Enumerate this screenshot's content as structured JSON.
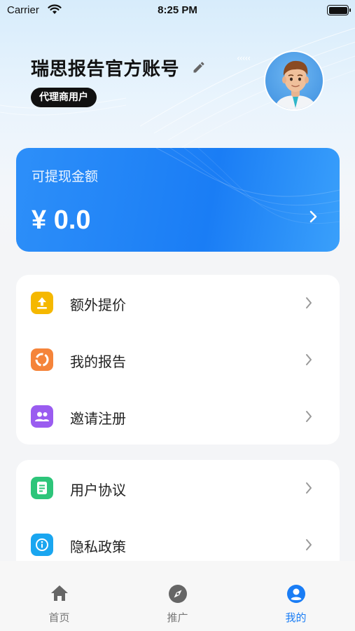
{
  "status": {
    "carrier": "Carrier",
    "time": "8:25 PM"
  },
  "profile": {
    "name": "瑞思报告官方账号",
    "role": "代理商用户"
  },
  "balance": {
    "label": "可提现金额",
    "amount": "¥ 0.0"
  },
  "menu_group_1": [
    {
      "label": "额外提价",
      "icon": "upload-icon",
      "color": "#F5B800"
    },
    {
      "label": "我的报告",
      "icon": "report-cycle-icon",
      "color": "#F5843A"
    },
    {
      "label": "邀请注册",
      "icon": "people-icon",
      "color": "#9A5CF0"
    }
  ],
  "menu_group_2": [
    {
      "label": "用户协议",
      "icon": "document-icon",
      "color": "#2DC57A"
    },
    {
      "label": "隐私政策",
      "icon": "info-icon",
      "color": "#1AA6F0"
    }
  ],
  "tabbar": {
    "tabs": [
      {
        "label": "首页",
        "icon": "home-icon",
        "active": false
      },
      {
        "label": "推广",
        "icon": "compass-icon",
        "active": false
      },
      {
        "label": "我的",
        "icon": "user-circle-icon",
        "active": true
      }
    ]
  },
  "colors": {
    "accent": "#1A7DF5",
    "text": "#222222",
    "inactive": "#777777"
  }
}
